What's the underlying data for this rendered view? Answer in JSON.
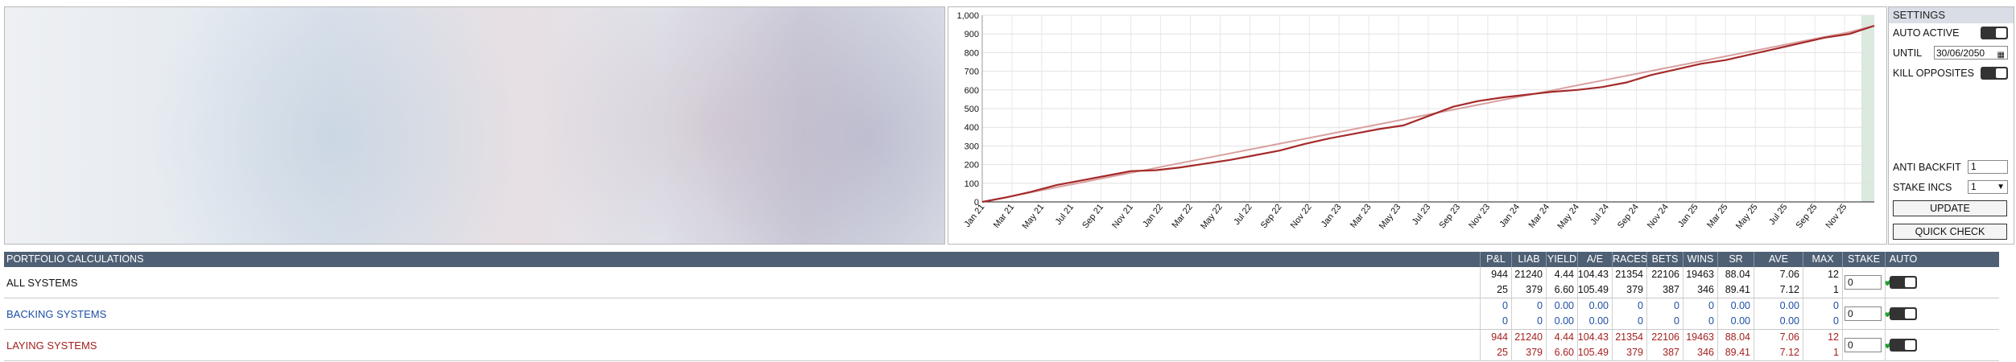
{
  "chart_data": {
    "type": "line",
    "ylim": [
      0,
      1000
    ],
    "yticks": [
      "0",
      "100",
      "200",
      "300",
      "400",
      "500",
      "600",
      "700",
      "800",
      "900",
      "1,000"
    ],
    "xticks": [
      "Jan 21",
      "Mar 21",
      "May 21",
      "Jul 21",
      "Sep 21",
      "Nov 21",
      "Jan 22",
      "Mar 22",
      "May 22",
      "Jul 22",
      "Sep 22",
      "Nov 22",
      "Jan 23",
      "Mar 23",
      "May 23",
      "Jul 23",
      "Sep 23",
      "Nov 23",
      "Jan 24",
      "Mar 24",
      "May 24",
      "Jul 24",
      "Sep 24",
      "Nov 24",
      "Jan 25",
      "Mar 25",
      "May 25",
      "Jul 25",
      "Sep 25",
      "Nov 25"
    ],
    "series": [
      {
        "color": "#a52a2a",
        "values": [
          0,
          25,
          55,
          90,
          115,
          140,
          165,
          170,
          185,
          205,
          225,
          250,
          275,
          310,
          340,
          365,
          390,
          410,
          460,
          510,
          540,
          560,
          575,
          590,
          600,
          615,
          640,
          680,
          710,
          740,
          760,
          790,
          820,
          850,
          880,
          900,
          944
        ]
      },
      {
        "color": "#d9a0a0",
        "values": [
          0,
          26,
          52,
          78,
          104,
          130,
          156,
          182,
          208,
          234,
          260,
          286,
          312,
          338,
          364,
          390,
          416,
          442,
          468,
          494,
          520,
          546,
          572,
          598,
          624,
          650,
          676,
          702,
          728,
          754,
          780,
          806,
          832,
          858,
          884,
          910,
          944
        ]
      }
    ],
    "grid": true
  },
  "settings": {
    "header": "SETTINGS",
    "auto_active": "AUTO ACTIVE",
    "until": "UNTIL",
    "until_value": "30/06/2050",
    "kill_opposites": "KILL OPPOSITES",
    "anti_backfit": "ANTI BACKFIT",
    "anti_backfit_value": "1",
    "stake_incs": "STAKE INCS",
    "stake_incs_value": "1",
    "update": "UPDATE",
    "quick_check": "QUICK CHECK"
  },
  "table": {
    "title": "PORTFOLIO CALCULATIONS",
    "columns": [
      "P&L",
      "LIAB",
      "YIELD",
      "A/E",
      "RACES",
      "BETS",
      "WINS",
      "SR",
      "AVE ODDS",
      "MAX DD",
      "STAKE",
      "AUTO"
    ],
    "rows": [
      {
        "label": "ALL SYSTEMS",
        "color": "#111111",
        "top": [
          "944",
          "21240",
          "4.44",
          "104.43",
          "21354",
          "22106",
          "19463",
          "88.04",
          "7.06",
          "12"
        ],
        "bottom": [
          "25",
          "379",
          "6.60",
          "105.49",
          "379",
          "387",
          "346",
          "89.41",
          "7.12",
          "1"
        ],
        "stake": "0"
      },
      {
        "label": "BACKING SYSTEMS",
        "color": "#1e4fa3",
        "top": [
          "0",
          "0",
          "0.00",
          "0.00",
          "0",
          "0",
          "0",
          "0.00",
          "0.00",
          "0"
        ],
        "bottom": [
          "0",
          "0",
          "0.00",
          "0.00",
          "0",
          "0",
          "0",
          "0.00",
          "0.00",
          "0"
        ],
        "stake": "0"
      },
      {
        "label": "LAYING SYSTEMS",
        "color": "#a3211f",
        "top": [
          "944",
          "21240",
          "4.44",
          "104.43",
          "21354",
          "22106",
          "19463",
          "88.04",
          "7.06",
          "12"
        ],
        "bottom": [
          "25",
          "379",
          "6.60",
          "105.49",
          "379",
          "387",
          "346",
          "89.41",
          "7.12",
          "1"
        ],
        "stake": "0"
      }
    ]
  }
}
